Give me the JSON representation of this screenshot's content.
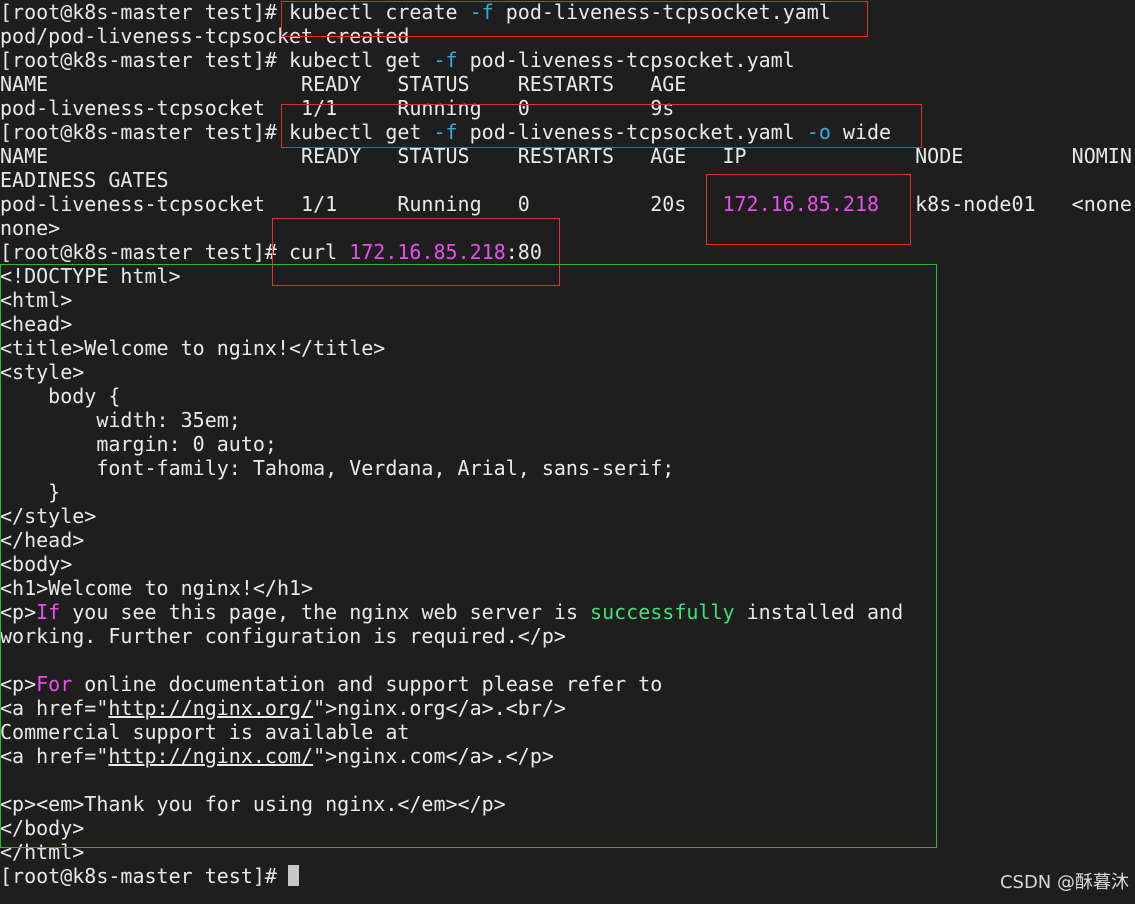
{
  "window": {
    "background": "#1e1e1e",
    "text_color": "#e8e8e8"
  },
  "colors": {
    "magenta": "#e94fe9",
    "cyan": "#3ba8e0",
    "green": "#3ee07a",
    "highlight_red": "#e03030",
    "highlight_green": "#2fb52f"
  },
  "terminal": {
    "lines": [
      [
        {
          "t": "[root@k8s-master test]# kubectl create "
        },
        {
          "t": "-f",
          "c": "cyan"
        },
        {
          "t": " pod-liveness-tcpsocket.yaml"
        }
      ],
      [
        {
          "t": "pod/pod-liveness-tcpsocket created"
        }
      ],
      [
        {
          "t": "[root@k8s-master test]# kubectl get "
        },
        {
          "t": "-f",
          "c": "cyan"
        },
        {
          "t": " pod-liveness-tcpsocket.yaml"
        }
      ],
      [
        {
          "t": "NAME                     READY   STATUS    RESTARTS   AGE"
        }
      ],
      [
        {
          "t": "pod-liveness-tcpsocket   1/1     Running   0          9s"
        }
      ],
      [
        {
          "t": "[root@k8s-master test]# kubectl get "
        },
        {
          "t": "-f",
          "c": "cyan"
        },
        {
          "t": " pod-liveness-tcpsocket.yaml "
        },
        {
          "t": "-o",
          "c": "cyan"
        },
        {
          "t": " wide"
        }
      ],
      [
        {
          "t": "NAME                     READY   STATUS    RESTARTS   AGE   IP              NODE         NOMIN"
        }
      ],
      [
        {
          "t": "EADINESS GATES"
        }
      ],
      [
        {
          "t": "pod-liveness-tcpsocket   1/1     Running   0          20s   "
        },
        {
          "t": "172.16.85.218",
          "c": "magenta"
        },
        {
          "t": "   k8s-node01   <none"
        }
      ],
      [
        {
          "t": "none>"
        }
      ],
      [
        {
          "t": "[root@k8s-master test]# curl "
        },
        {
          "t": "172.16.85.218",
          "c": "magenta"
        },
        {
          "t": ":80"
        }
      ],
      [
        {
          "t": "<!DOCTYPE html>"
        }
      ],
      [
        {
          "t": "<html>"
        }
      ],
      [
        {
          "t": "<head>"
        }
      ],
      [
        {
          "t": "<title>Welcome to nginx!</title>"
        }
      ],
      [
        {
          "t": "<style>"
        }
      ],
      [
        {
          "t": "    body {"
        }
      ],
      [
        {
          "t": "        width: 35em;"
        }
      ],
      [
        {
          "t": "        margin: 0 auto;"
        }
      ],
      [
        {
          "t": "        font-family: Tahoma, Verdana, Arial, sans-serif;"
        }
      ],
      [
        {
          "t": "    }"
        }
      ],
      [
        {
          "t": "</style>"
        }
      ],
      [
        {
          "t": "</head>"
        }
      ],
      [
        {
          "t": "<body>"
        }
      ],
      [
        {
          "t": "<h1>Welcome to nginx!</h1>"
        }
      ],
      [
        {
          "t": "<p>"
        },
        {
          "t": "If",
          "c": "magenta"
        },
        {
          "t": " you see this page, the nginx web server is "
        },
        {
          "t": "successfully",
          "c": "green"
        },
        {
          "t": " installed and"
        }
      ],
      [
        {
          "t": "working. Further configuration is required.</p>"
        }
      ],
      [
        {
          "t": ""
        }
      ],
      [
        {
          "t": "<p>"
        },
        {
          "t": "For",
          "c": "magenta"
        },
        {
          "t": " online documentation and support please refer to"
        }
      ],
      [
        {
          "t": "<a href=\""
        },
        {
          "t": "http://nginx.org/",
          "c": "underline"
        },
        {
          "t": "\">nginx.org</a>.<br/>"
        }
      ],
      [
        {
          "t": "Commercial support is available at"
        }
      ],
      [
        {
          "t": "<a href=\""
        },
        {
          "t": "http://nginx.com/",
          "c": "underline"
        },
        {
          "t": "\">nginx.com</a>.</p>"
        }
      ],
      [
        {
          "t": ""
        }
      ],
      [
        {
          "t": "<p><em>Thank you for using nginx.</em></p>"
        }
      ],
      [
        {
          "t": "</body>"
        }
      ],
      [
        {
          "t": "</html>"
        }
      ],
      [
        {
          "t": "[root@k8s-master test]# "
        }
      ]
    ]
  },
  "watermark": "CSDN @酥暮沐"
}
